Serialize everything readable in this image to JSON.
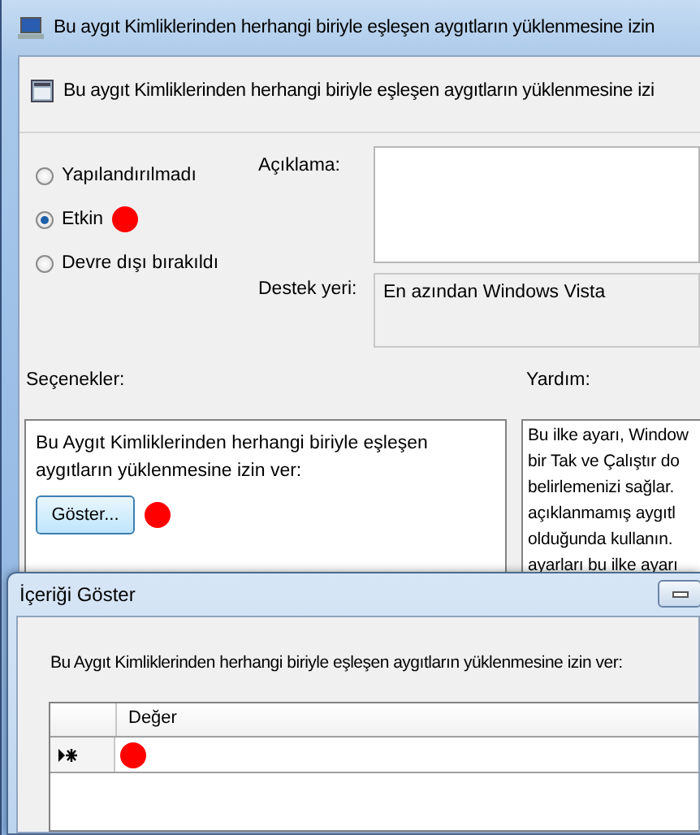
{
  "window": {
    "title": "Bu aygıt Kimliklerinden herhangi biriyle eşleşen aygıtların yüklenmesine izin"
  },
  "policy": {
    "title": "Bu aygıt Kimliklerinden herhangi biriyle eşleşen aygıtların yüklenmesine izi"
  },
  "state_options": [
    {
      "label": "Yapılandırılmadı",
      "selected": false
    },
    {
      "label": "Etkin",
      "selected": true
    },
    {
      "label": "Devre dışı bırakıldı",
      "selected": false
    }
  ],
  "comment": {
    "label": "Açıklama:"
  },
  "supported_on": {
    "label": "Destek yeri:",
    "value": "En azından Windows Vista"
  },
  "options": {
    "label": "Seçenekler:",
    "text": "Bu Aygıt Kimliklerinden herhangi biriyle eşleşen aygıtların yüklenmesine izin ver:",
    "button": "Göster..."
  },
  "help": {
    "label": "Yardım:",
    "lines": [
      "Bu ilke ayarı, Window",
      "bir Tak ve Çalıştır do",
      "belirlemenizi sağlar.",
      "açıklanmamış aygıtl",
      "olduğunda kullanın.",
      "ayarları bu ilke ayarı"
    ]
  },
  "dialog": {
    "title": "İçeriği Göster",
    "prompt": "Bu Aygıt Kimliklerinden herhangi biriyle eşleşen aygıtların yüklenmesine izin ver:",
    "columns": [
      "Değer"
    ]
  }
}
